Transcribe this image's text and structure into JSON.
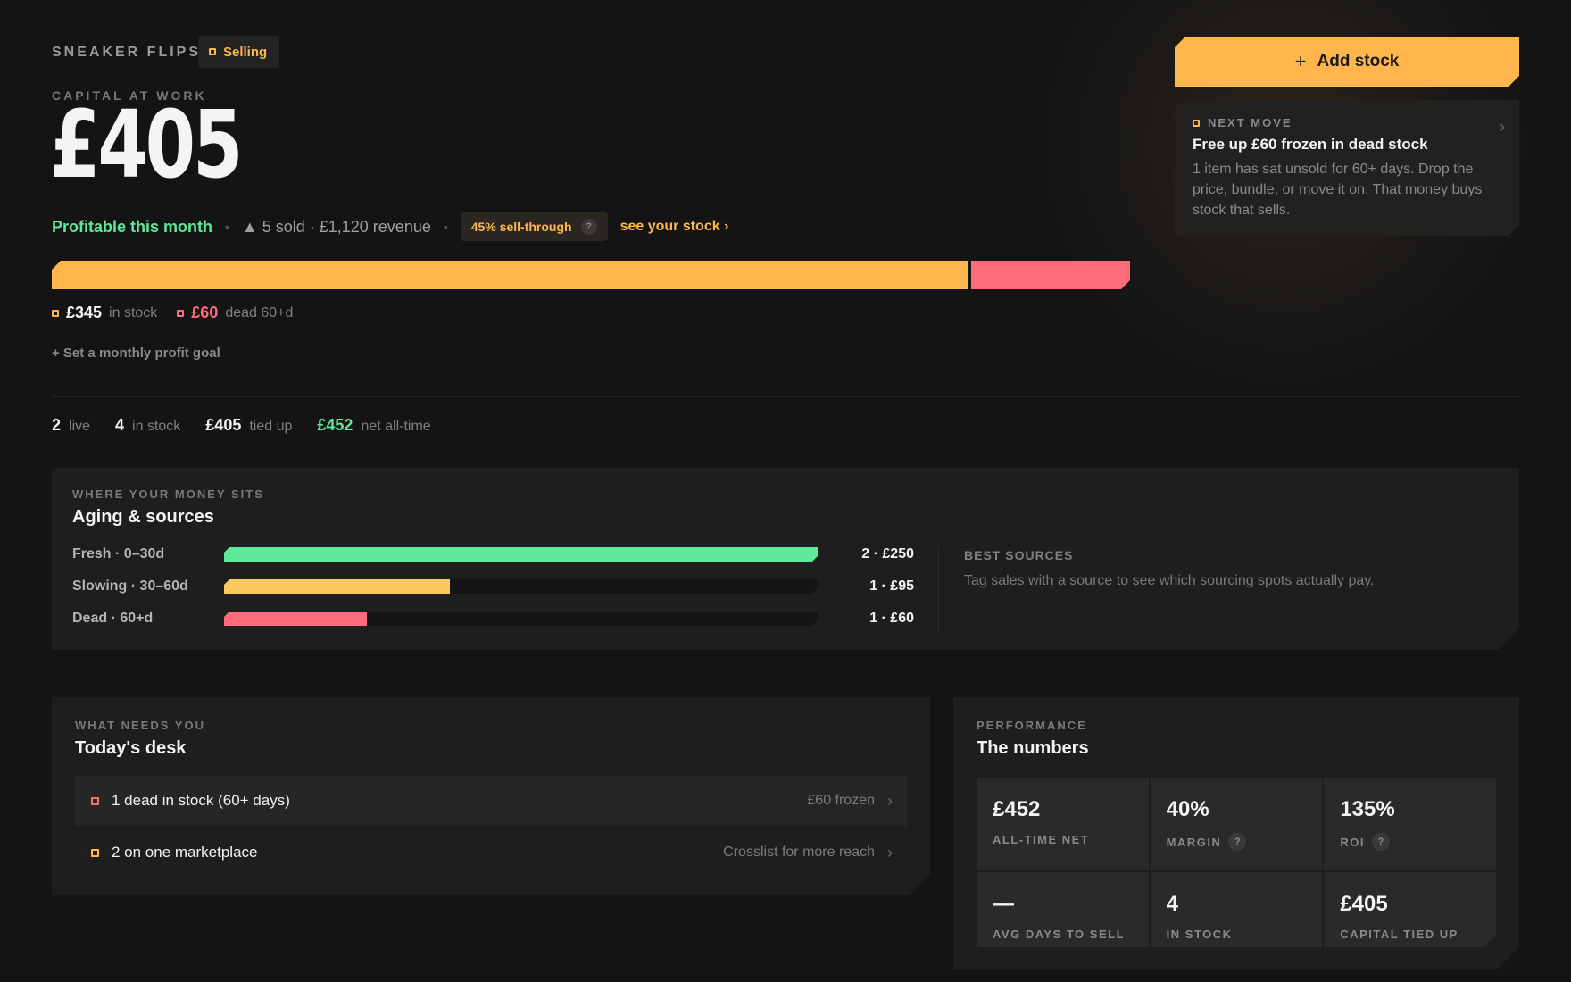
{
  "header": {
    "brand": "SNEAKER FLIPS",
    "status": "Selling"
  },
  "capital": {
    "label": "CAPITAL AT WORK",
    "value": "£405"
  },
  "summary": {
    "profit_text": "Profitable this month",
    "sold_text": "▲ 5 sold · £1,120 revenue",
    "sell_through_badge": "45% sell-through",
    "help_glyph": "?",
    "see_stock_link": "see your stock ›"
  },
  "stock_bar": {
    "in_stock_fraction": 0.852,
    "dead_fraction": 0.148,
    "in_stock_value": "£345",
    "in_stock_label": "in stock",
    "dead_value": "£60",
    "dead_label": "dead 60+d"
  },
  "goal_link": "+ Set a monthly profit goal",
  "stats": [
    {
      "value": "2",
      "label": "live"
    },
    {
      "value": "4",
      "label": "in stock"
    },
    {
      "value": "£405",
      "label": "tied up"
    },
    {
      "value": "£452",
      "label": "net all-time"
    }
  ],
  "aging": {
    "eyebrow": "WHERE YOUR MONEY SITS",
    "title": "Aging & sources",
    "rows": [
      {
        "label": "Fresh · 0–30d",
        "value": "2 · £250",
        "fill": 1.0,
        "color": "#5ee89a"
      },
      {
        "label": "Slowing · 30–60d",
        "value": "1 · £95",
        "fill": 0.38,
        "color": "#ffc95e"
      },
      {
        "label": "Dead · 60+d",
        "value": "1 · £60",
        "fill": 0.24,
        "color": "#ff6b7a"
      }
    ],
    "best_sources_heading": "BEST SOURCES",
    "best_sources_text": "Tag sales with a source to see which sourcing spots actually pay."
  },
  "desk": {
    "eyebrow": "WHAT NEEDS YOU",
    "title": "Today's desk",
    "items": [
      {
        "text": "1 dead in stock (60+ days)",
        "meta": "£60 frozen",
        "color": "#ff6b7a"
      },
      {
        "text": "2 on one marketplace",
        "meta": "Crosslist for more reach",
        "color": "#ffb74d"
      }
    ]
  },
  "performance": {
    "eyebrow": "PERFORMANCE",
    "title": "The numbers",
    "cells": [
      {
        "value": "£452",
        "label": "ALL-TIME NET",
        "help": false
      },
      {
        "value": "40%",
        "label": "MARGIN",
        "help": true
      },
      {
        "value": "135%",
        "label": "ROI",
        "help": true
      },
      {
        "value": "—",
        "label": "AVG DAYS TO SELL",
        "help": false
      },
      {
        "value": "4",
        "label": "IN STOCK",
        "help": false
      },
      {
        "value": "£405",
        "label": "CAPITAL TIED UP",
        "help": false
      }
    ]
  },
  "actions": {
    "add_stock_plus": "+",
    "add_stock_label": "Add stock"
  },
  "next_move": {
    "label": "NEXT MOVE",
    "title": "Free up £60 frozen in dead stock",
    "body": "1 item has sat unsold for 60+ days. Drop the price, bundle, or move it on. That money buys stock that sells."
  },
  "colors": {
    "accent": "#ffb74d",
    "danger": "#ff6b7a",
    "positive": "#5ee89a",
    "background": "#141415"
  },
  "icons": {
    "status": "square-dot-icon",
    "chevron": "chevron-right-icon",
    "help": "help-circle-icon",
    "add": "plus-icon"
  }
}
